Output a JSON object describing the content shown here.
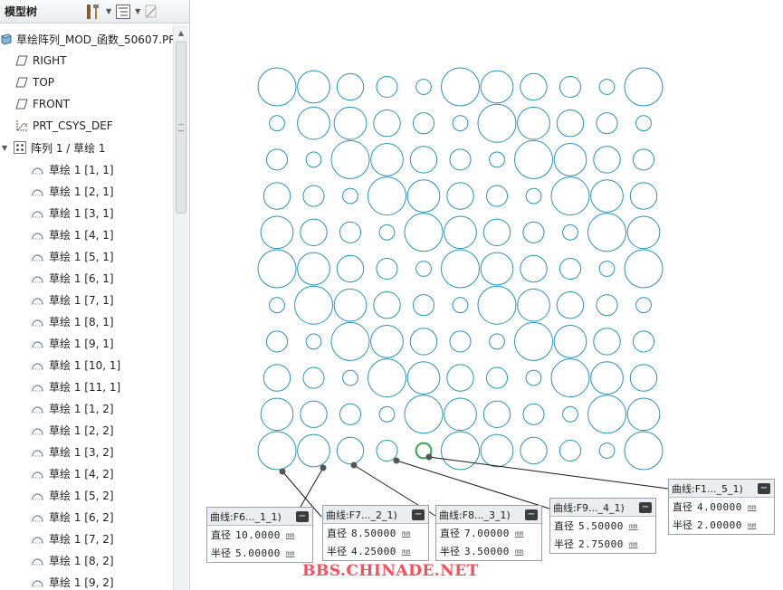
{
  "model_tree": {
    "title": "模型树",
    "root": "草绘阵列_MOD_函数_50607.PRT",
    "datums": [
      "RIGHT",
      "TOP",
      "FRONT"
    ],
    "csys": "PRT_CSYS_DEF",
    "pattern": "阵列 1 / 草绘 1",
    "items": [
      "草绘 1 [1, 1]",
      "草绘 1 [2, 1]",
      "草绘 1 [3, 1]",
      "草绘 1 [4, 1]",
      "草绘 1 [5, 1]",
      "草绘 1 [6, 1]",
      "草绘 1 [7, 1]",
      "草绘 1 [8, 1]",
      "草绘 1 [9, 1]",
      "草绘 1 [10, 1]",
      "草绘 1 [11, 1]",
      "草绘 1 [1, 2]",
      "草绘 1 [2, 2]",
      "草绘 1 [3, 2]",
      "草绘 1 [4, 2]",
      "草绘 1 [5, 2]",
      "草绘 1 [6, 2]",
      "草绘 1 [7, 2]",
      "草绘 1 [8, 2]",
      "草绘 1 [9, 2]"
    ]
  },
  "measurements": [
    {
      "title": "曲线:F6..._1_1)",
      "diameter_label": "直径",
      "diameter": "10.0000",
      "radius_label": "半径",
      "radius": "5.00000",
      "unit": "mm"
    },
    {
      "title": "曲线:F7..._2_1)",
      "diameter_label": "直径",
      "diameter": "8.50000",
      "radius_label": "半径",
      "radius": "4.25000",
      "unit": "mm"
    },
    {
      "title": "曲线:F8..._3_1)",
      "diameter_label": "直径",
      "diameter": "7.00000",
      "radius_label": "半径",
      "radius": "3.50000",
      "unit": "mm"
    },
    {
      "title": "曲线:F9..._4_1)",
      "diameter_label": "直径",
      "diameter": "5.50000",
      "radius_label": "半径",
      "radius": "2.75000",
      "unit": "mm"
    },
    {
      "title": "曲线:F1..._5_1)",
      "diameter_label": "直径",
      "diameter": "4.00000",
      "radius_label": "半径",
      "radius": "2.00000",
      "unit": "mm"
    }
  ],
  "watermark": "BBS.CHINADE.NET",
  "colors": {
    "circle_stroke": "#2a93b8",
    "selected_circle": "#2fa84f",
    "leader": "#1a1a1a",
    "watermark": "#ff4a5a"
  },
  "circle_grid": {
    "columns": 11,
    "rows": 11,
    "diameters_mm": [
      [
        10,
        8.5,
        7,
        5.5,
        4,
        10,
        8.5,
        7,
        5.5,
        4,
        10
      ],
      [
        4,
        8.5,
        8.5,
        7,
        5.5,
        4,
        10,
        8.5,
        7,
        5.5,
        4
      ],
      [
        5.5,
        4,
        10,
        8.5,
        7,
        5.5,
        4,
        10,
        8.5,
        7,
        5.5
      ],
      [
        7,
        5.5,
        4,
        10,
        8.5,
        7,
        5.5,
        4,
        10,
        8.5,
        7
      ],
      [
        8.5,
        7,
        5.5,
        4,
        10,
        8.5,
        7,
        5.5,
        4,
        10,
        8.5
      ],
      [
        10,
        8.5,
        7,
        5.5,
        4,
        10,
        8.5,
        7,
        5.5,
        4,
        10
      ],
      [
        4,
        10,
        8.5,
        7,
        5.5,
        4,
        10,
        8.5,
        7,
        5.5,
        4
      ],
      [
        5.5,
        4,
        10,
        8.5,
        7,
        5.5,
        4,
        10,
        8.5,
        7,
        5.5
      ],
      [
        7,
        5.5,
        4,
        10,
        8.5,
        7,
        5.5,
        4,
        10,
        8.5,
        7
      ],
      [
        8.5,
        7,
        5.5,
        4,
        10,
        8.5,
        7,
        5.5,
        4,
        10,
        8.5
      ],
      [
        10,
        8.5,
        7,
        5.5,
        4,
        10,
        8.5,
        7,
        5.5,
        4,
        10
      ]
    ],
    "selected": {
      "row": 10,
      "column": 4
    }
  }
}
